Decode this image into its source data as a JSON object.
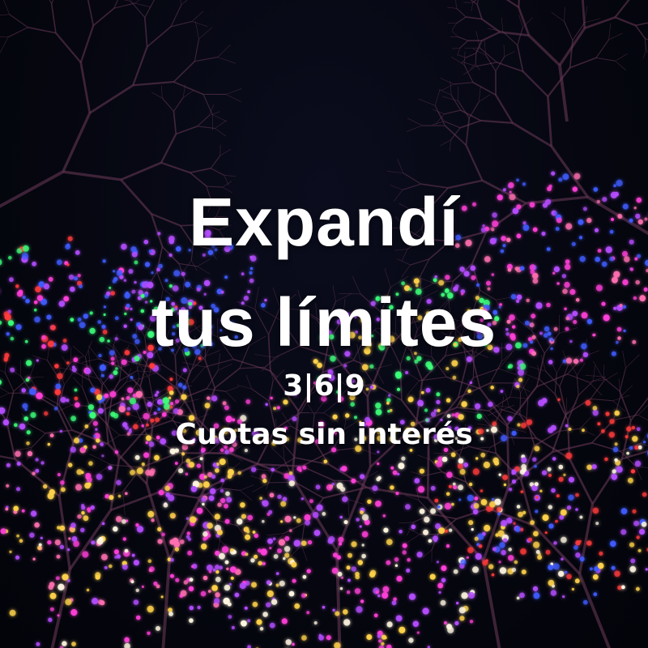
{
  "promo": {
    "title_line1": "Expandí",
    "title_line2": "tus límites",
    "installments": "3|6|9",
    "subtitle": "Cuotas sin interés"
  },
  "background": {
    "description_colors": {
      "sky": "#05060f",
      "branch": "#6e3a5a",
      "light_magenta": "#ff3fd8",
      "light_pink": "#ff6fb0",
      "light_purple": "#b44cff",
      "light_blue": "#3f5bff",
      "light_green": "#3cff7a",
      "light_yellow": "#ffd24a",
      "light_white": "#fff6e0",
      "light_red": "#ff3a3a"
    }
  }
}
